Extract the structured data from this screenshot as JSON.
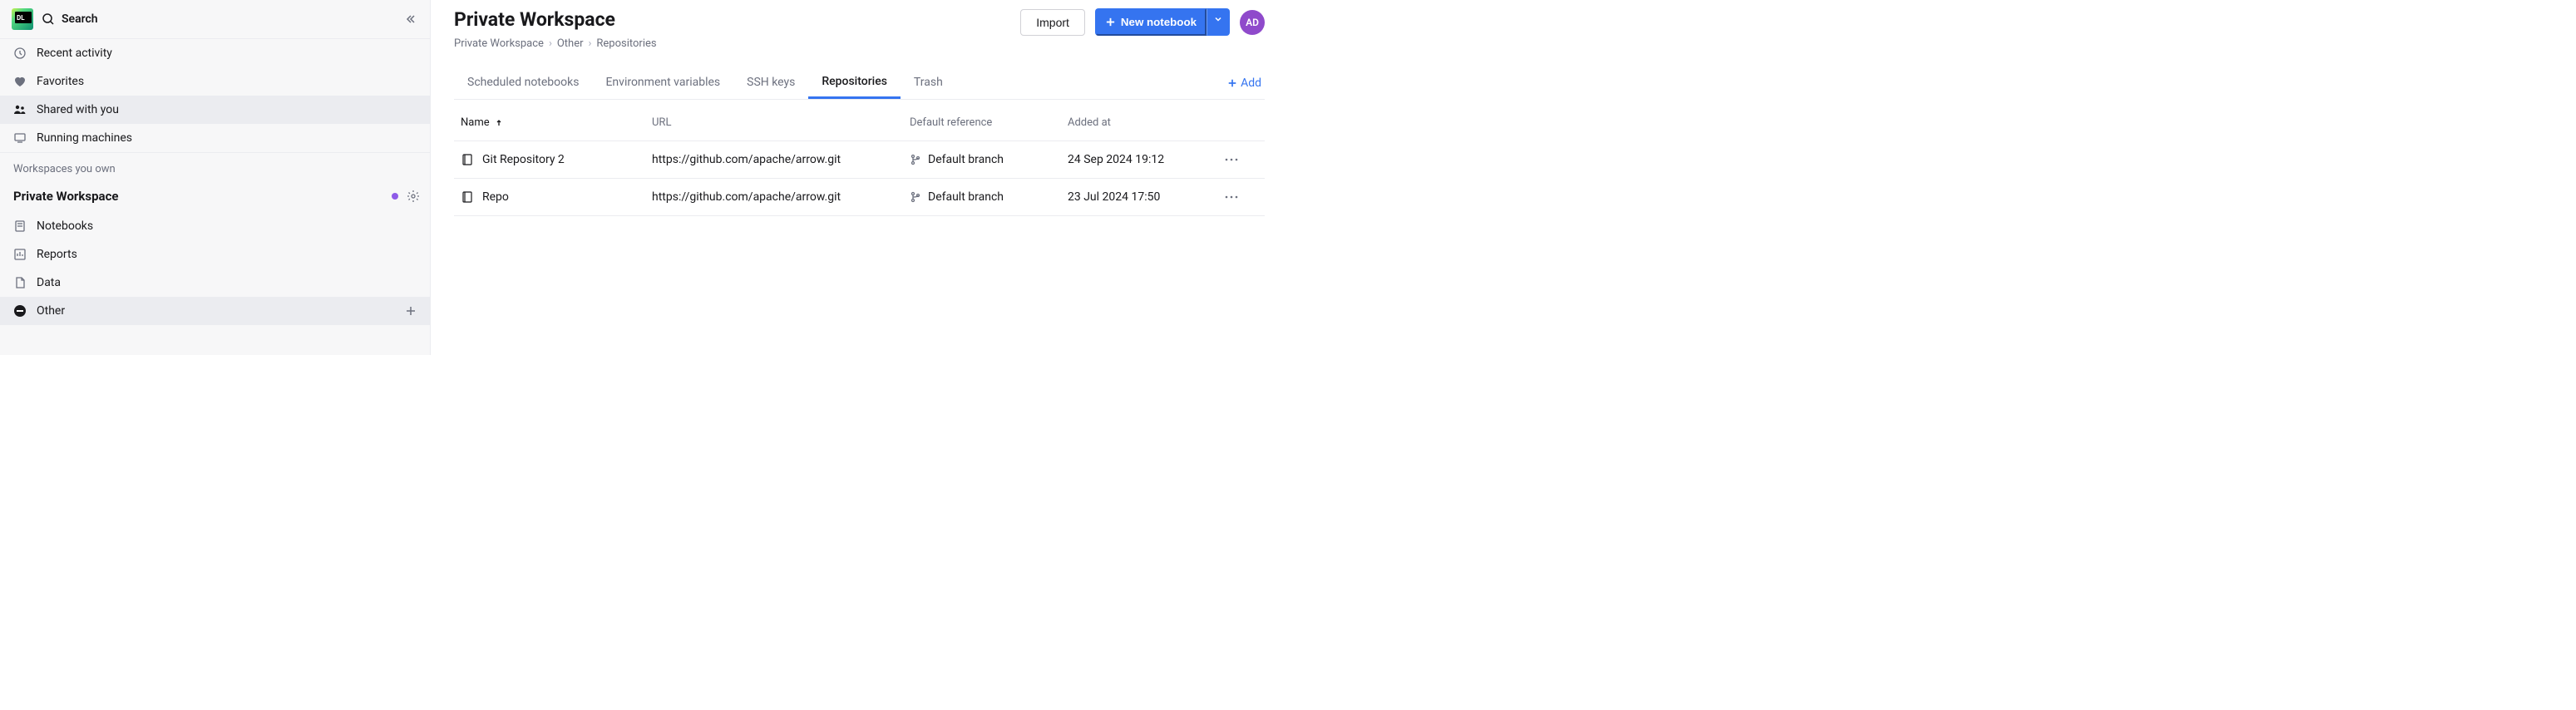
{
  "sidebar": {
    "search_label": "Search",
    "nav": [
      {
        "label": "Recent activity"
      },
      {
        "label": "Favorites"
      },
      {
        "label": "Shared with you"
      },
      {
        "label": "Running machines"
      }
    ],
    "section_label": "Workspaces you own",
    "workspace_title": "Private Workspace",
    "ws_items": [
      {
        "label": "Notebooks"
      },
      {
        "label": "Reports"
      },
      {
        "label": "Data"
      },
      {
        "label": "Other"
      }
    ]
  },
  "header": {
    "title": "Private Workspace",
    "import_label": "Import",
    "new_notebook_label": "New notebook",
    "avatar_initials": "AD"
  },
  "breadcrumb": {
    "a": "Private Workspace",
    "b": "Other",
    "c": "Repositories"
  },
  "tabs": {
    "t0": "Scheduled notebooks",
    "t1": "Environment variables",
    "t2": "SSH keys",
    "t3": "Repositories",
    "t4": "Trash",
    "add_label": "Add"
  },
  "table": {
    "headers": {
      "name": "Name",
      "url": "URL",
      "ref": "Default reference",
      "added": "Added at"
    },
    "rows": [
      {
        "name": "Git Repository 2",
        "url": "https://github.com/apache/arrow.git",
        "ref": "Default branch",
        "added": "24 Sep 2024 19:12"
      },
      {
        "name": "Repo",
        "url": "https://github.com/apache/arrow.git",
        "ref": "Default branch",
        "added": "23 Jul 2024 17:50"
      }
    ]
  }
}
